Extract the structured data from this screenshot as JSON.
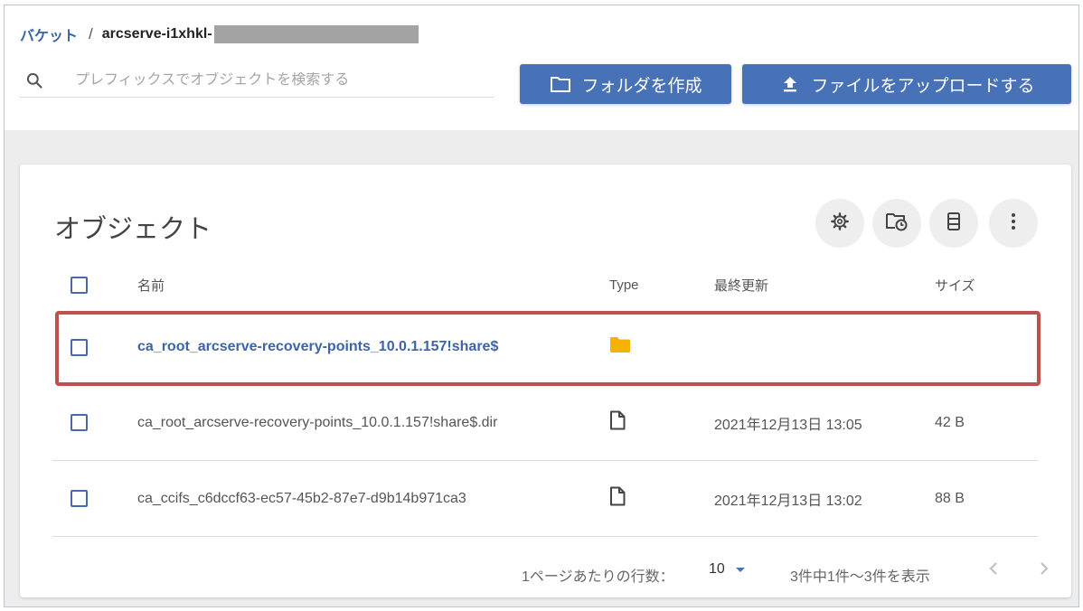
{
  "breadcrumb": {
    "root_label": "バケット",
    "separator": "/",
    "current_label": "arcserve-i1xhkl-"
  },
  "search": {
    "placeholder": "プレフィックスでオブジェクトを検索する",
    "value": "",
    "icon": "search-icon"
  },
  "toolbar": {
    "create_folder_label": "フォルダを作成",
    "create_folder_icon": "folder-outline-icon",
    "upload_label": "ファイルをアップロードする",
    "upload_icon": "upload-icon",
    "button_color": "#4772b8"
  },
  "objects": {
    "title": "オブジェクト",
    "actions": [
      "settings-gear-icon",
      "folder-history-icon",
      "column-view-icon",
      "more-vertical-icon"
    ],
    "columns": {
      "name": "名前",
      "type": "Type",
      "modified": "最終更新",
      "size": "サイズ"
    },
    "rows": [
      {
        "name": "ca_root_arcserve-recovery-points_10.0.1.157!share$",
        "type_icon": "folder-icon",
        "modified": "",
        "size": "",
        "highlighted": true
      },
      {
        "name": "ca_root_arcserve-recovery-points_10.0.1.157!share$.dir",
        "type_icon": "file-icon",
        "modified": "2021年12月13日 13:05",
        "size": "42 B",
        "highlighted": false
      },
      {
        "name": "ca_ccifs_c6dccf63-ec57-45b2-87e7-d9b14b971ca3",
        "type_icon": "file-icon",
        "modified": "2021年12月13日 13:02",
        "size": "88 B",
        "highlighted": false
      }
    ],
    "highlight_color": "#c0504d",
    "folder_color": "#f5b300"
  },
  "pagination": {
    "rows_per_page_label": "1ページあたりの行数：",
    "rows_per_page_value": "10",
    "range_text": "3件中1件〜3件を表示",
    "prev_icon": "chevron-left-icon",
    "next_icon": "chevron-right-icon"
  }
}
